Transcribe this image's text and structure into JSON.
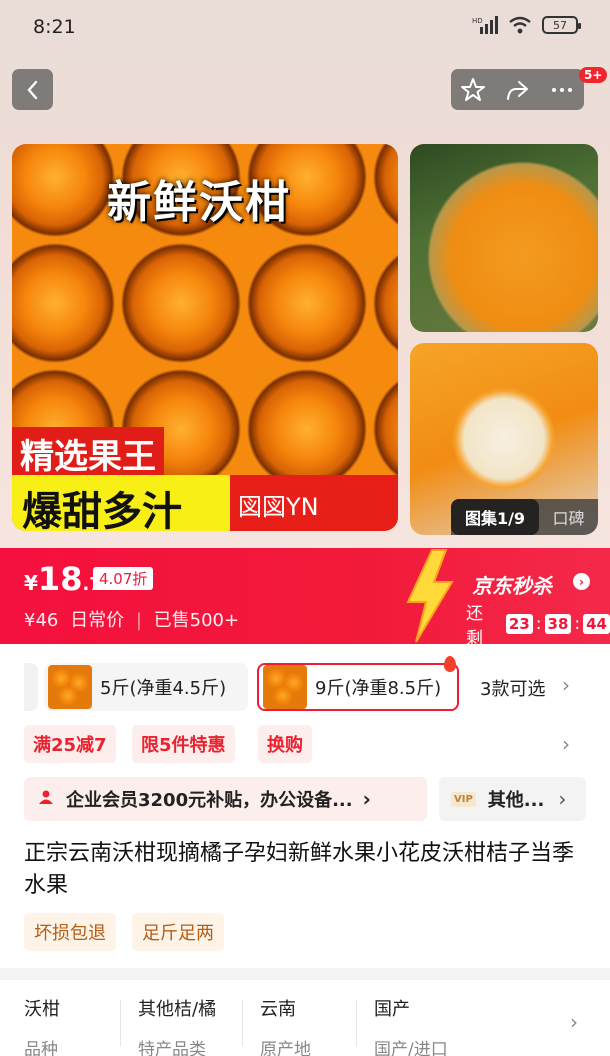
{
  "status_bar": {
    "time": "8:21",
    "battery": "57"
  },
  "nav": {
    "cart_badge": "5+"
  },
  "gallery": {
    "main_caption": "新鲜沃柑",
    "tag_line1": "精选果王",
    "tag_line2": "爆甜多汁",
    "tag_line3": "図図YN",
    "counter_label": "图集1/9",
    "reviews_label": "口碑"
  },
  "price": {
    "currency": "¥",
    "integer": "18",
    "decimal": ".7",
    "discount": "4.07折",
    "original": "¥46",
    "original_label": "日常价",
    "sold": "已售500+"
  },
  "flash_sale": {
    "title": "京东秒杀",
    "remaining_label": "还剩",
    "hours": "23",
    "minutes": "38",
    "seconds": "44"
  },
  "variants": [
    {
      "label": "5斤(净重4.5斤)",
      "selected": false
    },
    {
      "label": "9斤(净重8.5斤)",
      "selected": true
    }
  ],
  "variants_more": "3款可选",
  "promos": [
    "满25减7",
    "限5件特惠",
    "换购"
  ],
  "enterprise": {
    "text": "企业会员3200元补贴，办公设备...",
    "other": "其他..."
  },
  "product_title": "正宗云南沃柑现摘橘子孕妇新鲜水果小花皮沃柑桔子当季水果",
  "services": [
    "坏损包退",
    "足斤足两"
  ],
  "attributes": [
    {
      "value": "沃柑",
      "key": "品种"
    },
    {
      "value": "其他桔/橘",
      "key": "特产品类"
    },
    {
      "value": "云南",
      "key": "原产地"
    },
    {
      "value": "国产",
      "key": "国产/进口"
    }
  ],
  "colors": {
    "accent": "#f2163c",
    "promo_text": "#ea2330",
    "service_text": "#b45e16"
  }
}
